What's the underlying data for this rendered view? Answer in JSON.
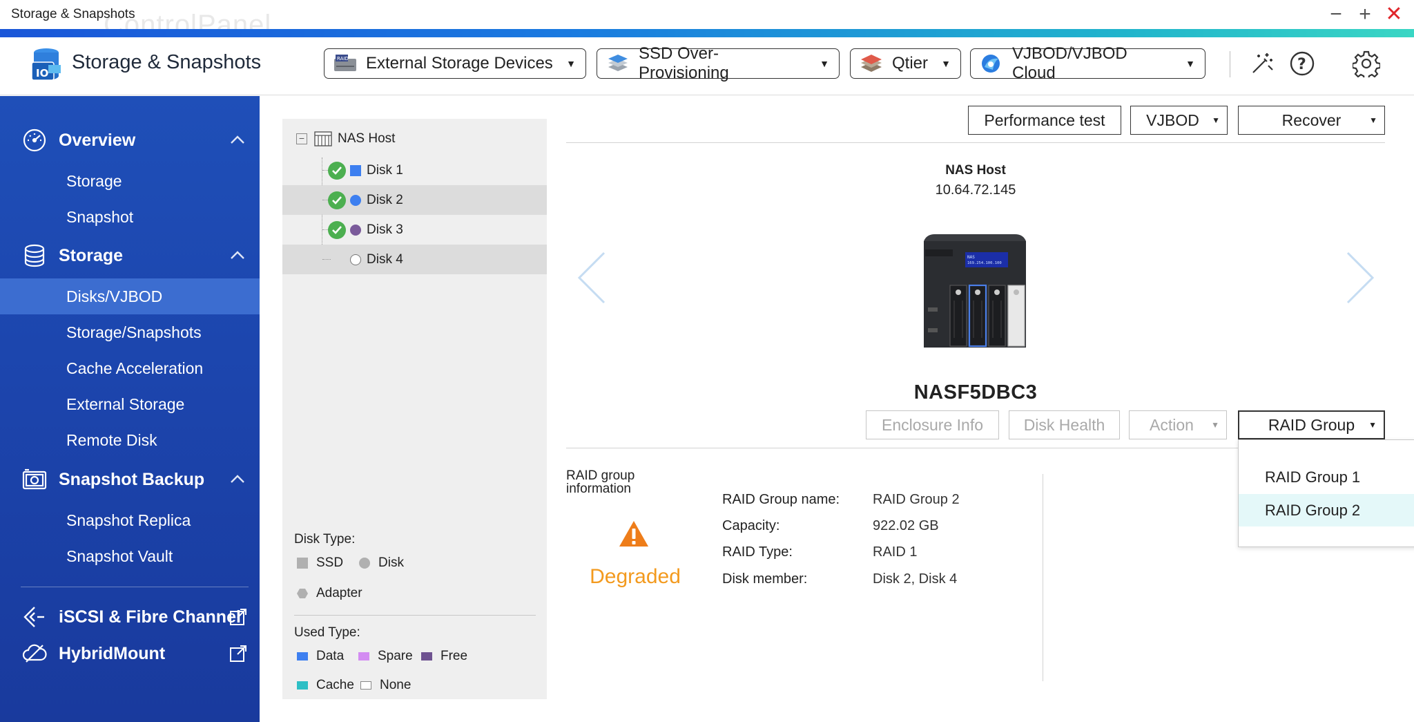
{
  "window": {
    "title": "Storage & Snapshots",
    "ghost_title": "ControlPanel",
    "controls": {
      "minimize": "−",
      "maximize": "+",
      "close": "✕"
    }
  },
  "header": {
    "app_title": "Storage & Snapshots",
    "menus": [
      {
        "label": "External Storage Devices",
        "icon": "raid-device-icon"
      },
      {
        "label": "SSD Over-Provisioning",
        "icon": "ssd-stack-icon"
      },
      {
        "label": "Qtier",
        "icon": "qtier-layers-icon"
      },
      {
        "label": "VJBOD/VJBOD Cloud",
        "icon": "vjbod-cloud-icon"
      }
    ],
    "icons": [
      "magic-wand-icon",
      "help-icon",
      "gear-icon"
    ]
  },
  "sidebar": {
    "overview": {
      "label": "Overview",
      "items": [
        "Storage",
        "Snapshot"
      ]
    },
    "storage": {
      "label": "Storage",
      "items": [
        "Disks/VJBOD",
        "Storage/Snapshots",
        "Cache Acceleration",
        "External Storage",
        "Remote Disk"
      ],
      "active": "Disks/VJBOD"
    },
    "snapshot_backup": {
      "label": "Snapshot Backup",
      "items": [
        "Snapshot Replica",
        "Snapshot Vault"
      ]
    },
    "links": [
      {
        "label": "iSCSI & Fibre Channel"
      },
      {
        "label": "HybridMount"
      }
    ]
  },
  "tree": {
    "root": "NAS Host",
    "disks": [
      {
        "label": "Disk 1",
        "status": "ok",
        "color": "#3d7ff0",
        "shape": "square"
      },
      {
        "label": "Disk 2",
        "status": "ok",
        "color": "#3d7ff0",
        "shape": "circle"
      },
      {
        "label": "Disk 3",
        "status": "ok",
        "color": "#7a5a9a",
        "shape": "circle"
      },
      {
        "label": "Disk 4",
        "status": "none",
        "color": "#ffffff",
        "shape": "circle"
      }
    ],
    "selected": [
      "Disk 2",
      "Disk 4"
    ],
    "legend": {
      "disk_type_title": "Disk Type:",
      "disk_types": [
        "SSD",
        "Disk",
        "Adapter"
      ],
      "used_type_title": "Used Type:",
      "used_types": [
        {
          "label": "Data",
          "color": "#3d7ff0"
        },
        {
          "label": "Spare",
          "color": "#d38cf2"
        },
        {
          "label": "Free",
          "color": "#6e5290"
        },
        {
          "label": "Cache",
          "color": "#2dbfc5"
        },
        {
          "label": "None",
          "color": "#ffffff"
        }
      ]
    }
  },
  "toolbar": {
    "performance_test": "Performance test",
    "vjbod": "VJBOD",
    "recover": "Recover"
  },
  "device": {
    "host_label": "NAS Host",
    "ip": "10.64.72.145",
    "name": "NASF5DBC3",
    "lcd_line1": "NAS",
    "lcd_line2": "169.254.100.100"
  },
  "actions": {
    "enclosure_info": "Enclosure Info",
    "disk_health": "Disk Health",
    "action": "Action",
    "raid_group": "RAID Group"
  },
  "raid_menu": {
    "options": [
      "RAID Group 1",
      "RAID Group 2"
    ],
    "selected": "RAID Group 2"
  },
  "raid_info": {
    "title": "RAID group information",
    "status": "Degraded",
    "status_color": "#f39a1e",
    "rows": [
      {
        "label": "RAID Group name:",
        "value": "RAID Group 2"
      },
      {
        "label": "Capacity:",
        "value": "922.02 GB"
      },
      {
        "label": "RAID Type:",
        "value": "RAID 1"
      },
      {
        "label": "Disk member:",
        "value": "Disk 2, Disk 4"
      }
    ]
  }
}
